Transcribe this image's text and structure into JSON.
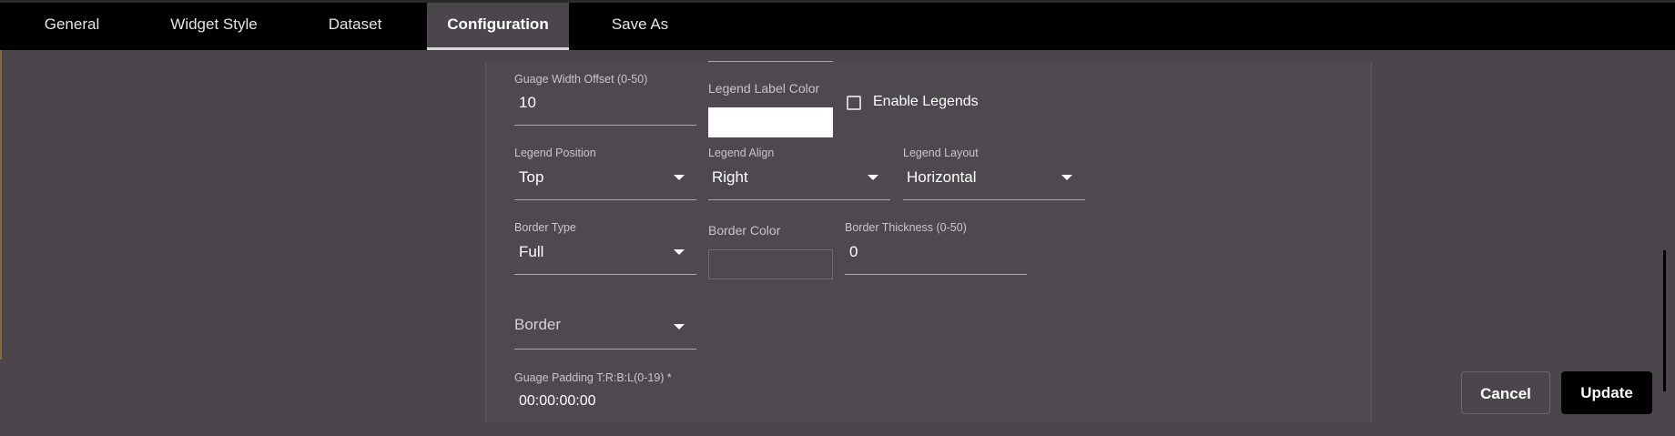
{
  "tabs": [
    {
      "label": "General",
      "active": false
    },
    {
      "label": "Widget Style",
      "active": false
    },
    {
      "label": "Dataset",
      "active": false
    },
    {
      "label": "Configuration",
      "active": true
    },
    {
      "label": "Save As",
      "active": false
    }
  ],
  "form": {
    "gauge_width_offset": {
      "label": "Guage Width Offset (0-50)",
      "value": "10"
    },
    "legend_label_color": {
      "label": "Legend Label Color",
      "color": "#ffffff"
    },
    "enable_legends": {
      "label": "Enable Legends",
      "checked": false
    },
    "legend_position": {
      "label": "Legend Position",
      "value": "Top"
    },
    "legend_align": {
      "label": "Legend Align",
      "value": "Right"
    },
    "legend_layout": {
      "label": "Legend Layout",
      "value": "Horizontal"
    },
    "border_type": {
      "label": "Border Type",
      "value": "Full"
    },
    "border_color": {
      "label": "Border Color",
      "color": ""
    },
    "border_thickness": {
      "label": "Border Thickness (0-50)",
      "value": "0"
    },
    "border_select": {
      "placeholder": "Border"
    },
    "gauge_padding": {
      "label": "Guage Padding T:R:B:L(0-19) *",
      "value": "00:00:00:00"
    }
  },
  "actions": {
    "cancel_label": "Cancel",
    "update_label": "Update"
  },
  "colors": {
    "background": "#4a464b",
    "tabbar": "#000000",
    "update_button": "#000000"
  }
}
